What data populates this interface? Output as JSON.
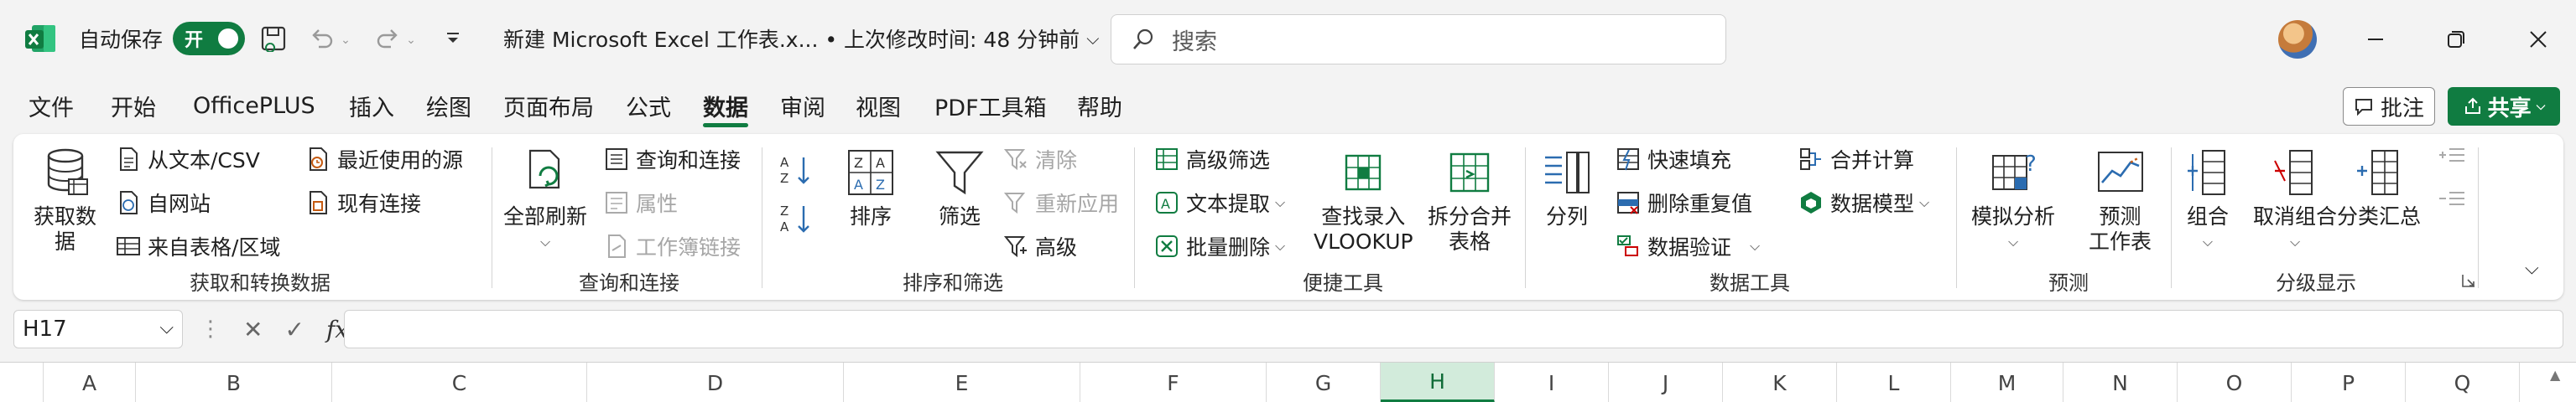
{
  "app": {
    "autosave_label": "自动保存",
    "toggle_state": "开",
    "doc_title": "新建 Microsoft Excel 工作表.x...  •  上次修改时间: 48 分钟前",
    "search_placeholder": "搜索",
    "accent_color": "#107c41"
  },
  "menu": {
    "tabs": [
      "文件",
      "开始",
      "OfficePLUS",
      "插入",
      "绘图",
      "页面布局",
      "公式",
      "数据",
      "审阅",
      "视图",
      "PDF工具箱",
      "帮助"
    ],
    "active_tab": "数据",
    "comments_label": "批注",
    "share_label": "共享"
  },
  "ribbon": {
    "groups": {
      "get_transform": "获取和转换数据",
      "queries": "查询和连接",
      "sort_filter": "排序和筛选",
      "quick_tools": "便捷工具",
      "data_tools": "数据工具",
      "forecast": "预测",
      "outline": "分级显示"
    },
    "get_data": [
      "获取数",
      "据"
    ],
    "from_text": "从文本/CSV",
    "from_web": "自网站",
    "from_table": "来自表格/区域",
    "recent_sources": "最近使用的源",
    "existing_connections": "现有连接",
    "refresh_all": "全部刷新",
    "queries_connections": "查询和连接",
    "properties": "属性",
    "edit_links": "工作簿链接",
    "sort": "排序",
    "filter": "筛选",
    "clear": "清除",
    "reapply": "重新应用",
    "advanced": "高级",
    "advanced_filter": "高级筛选",
    "text_extract": "文本提取",
    "batch_delete": "批量删除",
    "vlookup": [
      "查找录入",
      "VLOOKUP"
    ],
    "split_merge": [
      "拆分合并",
      "表格"
    ],
    "text_to_columns": "分列",
    "flash_fill": "快速填充",
    "remove_duplicates": "删除重复值",
    "data_validation": "数据验证",
    "consolidate": "合并计算",
    "data_model": "数据模型",
    "what_if": "模拟分析",
    "forecast_sheet": [
      "预测",
      "工作表"
    ],
    "group": "组合",
    "ungroup": "取消组合",
    "subtotal": "分类汇总"
  },
  "formula_bar": {
    "name_box": "H17",
    "fx": "fx",
    "formula": ""
  },
  "columns": [
    "A",
    "B",
    "C",
    "D",
    "E",
    "F",
    "G",
    "H",
    "I",
    "J",
    "K",
    "L",
    "M",
    "N",
    "O",
    "P",
    "Q"
  ],
  "selected_column": "H"
}
